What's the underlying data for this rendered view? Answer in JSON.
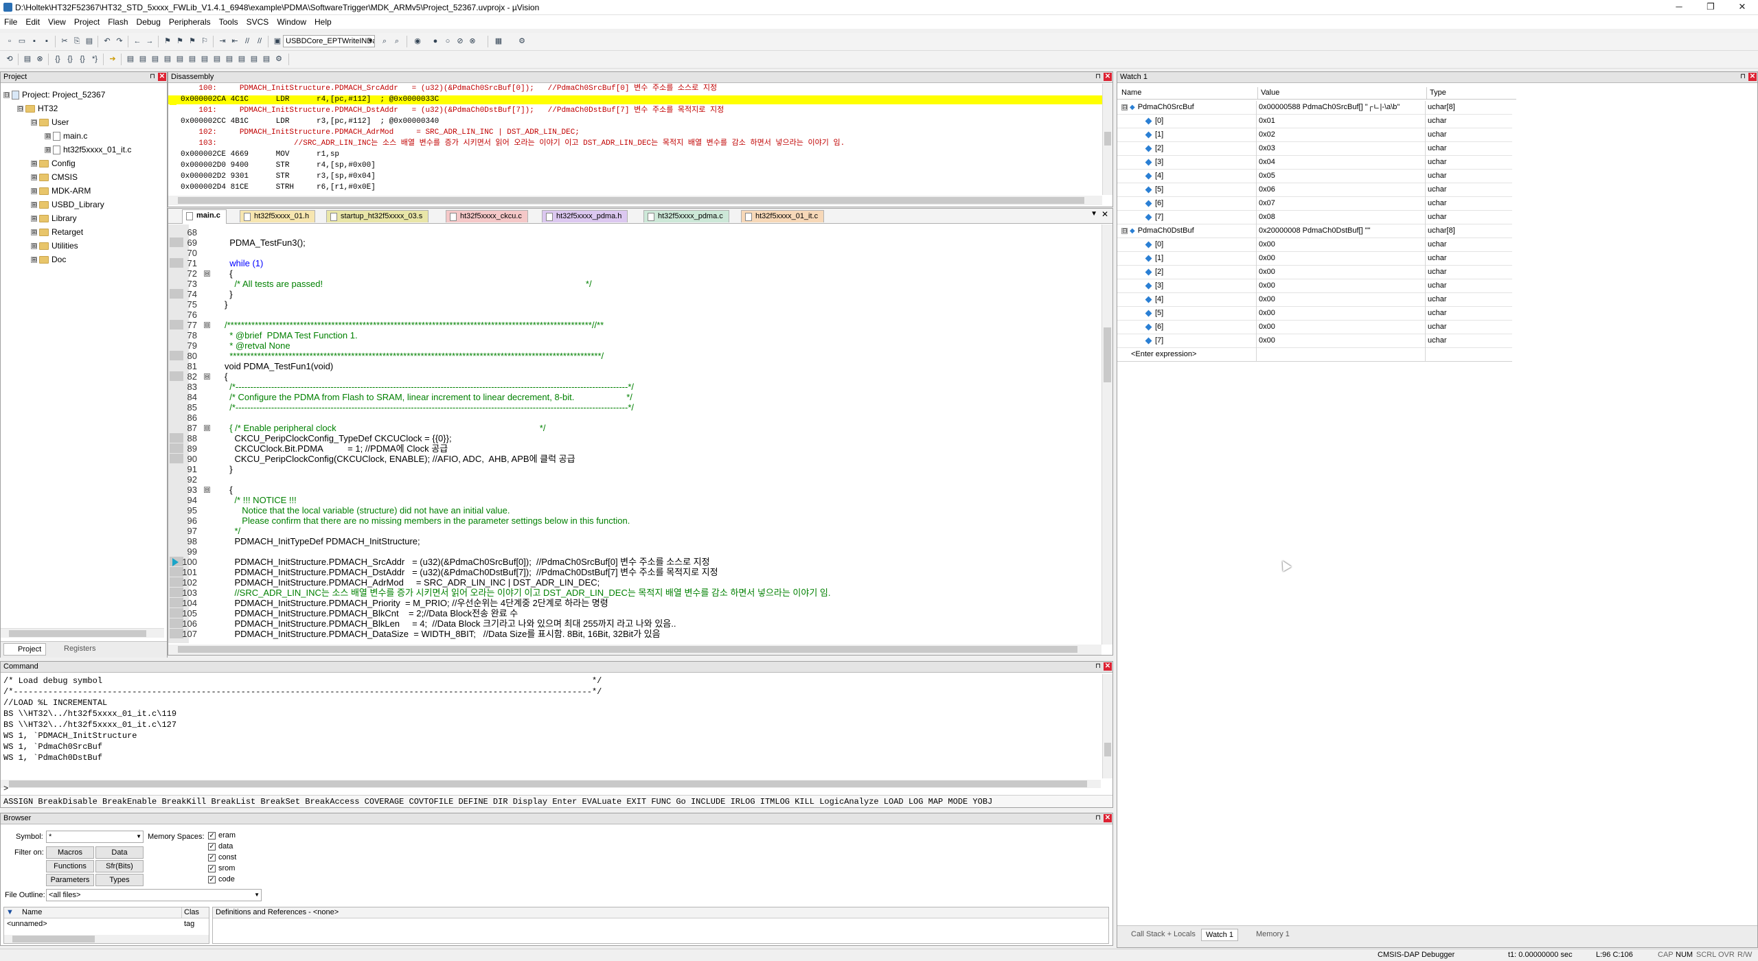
{
  "window": {
    "title": "D:\\Holtek\\HT32F52367\\HT32_STD_5xxxx_FWLib_V1.4.1_6948\\example\\PDMA\\SoftwareTrigger\\MDK_ARMv5\\Project_52367.uvprojx - µVision",
    "minimize": "─",
    "restore": "❐",
    "close": "✕"
  },
  "menu": [
    "File",
    "Edit",
    "View",
    "Project",
    "Flash",
    "Debug",
    "Peripherals",
    "Tools",
    "SVCS",
    "Window",
    "Help"
  ],
  "toolbar": {
    "target_dropdown": "USBDCore_EPTWriteINDa"
  },
  "project": {
    "title": "Project",
    "items": [
      {
        "label": "Project: Project_52367",
        "exp": "⊟"
      },
      {
        "label": "HT32",
        "exp": "⊟"
      },
      {
        "label": "User",
        "exp": "⊟"
      },
      {
        "label": "main.c",
        "exp": "⊞"
      },
      {
        "label": "ht32f5xxxx_01_it.c",
        "exp": "⊞"
      },
      {
        "label": "Config",
        "exp": "⊞"
      },
      {
        "label": "CMSIS",
        "exp": "⊞"
      },
      {
        "label": "MDK-ARM",
        "exp": "⊞"
      },
      {
        "label": "USBD_Library",
        "exp": "⊞"
      },
      {
        "label": "Library",
        "exp": "⊞"
      },
      {
        "label": "Retarget",
        "exp": "⊞"
      },
      {
        "label": "Utilities",
        "exp": "⊞"
      },
      {
        "label": "Doc",
        "exp": "⊞"
      }
    ],
    "tabs": [
      "Project",
      "Registers"
    ]
  },
  "disassembly": {
    "title": "Disassembly",
    "lines": [
      "    100:     PDMACH_InitStructure.PDMACH_SrcAddr   = (u32)(&PdmaCh0SrcBuf[0]);   //PdmaCh0SrcBuf[0] 변수 주소를 소스로 지정",
      "0x000002CA 4C1C      LDR      r4,[pc,#112]  ; @0x0000033C",
      "    101:     PDMACH_InitStructure.PDMACH_DstAddr   = (u32)(&PdmaCh0DstBuf[7]);   //PdmaCh0DstBuf[7] 변수 주소를 목적지로 지정",
      "0x000002CC 4B1C      LDR      r3,[pc,#112]  ; @0x00000340",
      "    102:     PDMACH_InitStructure.PDMACH_AdrMod     = SRC_ADR_LIN_INC | DST_ADR_LIN_DEC;",
      "    103:                 //SRC_ADR_LIN_INC는 소스 배열 변수를 증가 시키면서 읽어 오라는 이야기 이고 DST_ADR_LIN_DEC는 목적지 배열 변수를 감소 하면서 넣으라는 이야기 임.",
      "0x000002CE 4669      MOV      r1,sp",
      "0x000002D0 9400      STR      r4,[sp,#0x00]",
      "0x000002D2 9301      STR      r3,[sp,#0x04]",
      "0x000002D4 81CE      STRH     r6,[r1,#0x0E]"
    ]
  },
  "tabs": [
    {
      "label": "main.c",
      "color": "#f7e6b0",
      "active": true
    },
    {
      "label": "ht32f5xxxx_01.h",
      "color": "#f7e6b0"
    },
    {
      "label": "startup_ht32f5xxxx_03.s",
      "color": "#e9e6a8"
    },
    {
      "label": "ht32f5xxxx_ckcu.c",
      "color": "#f5c8c8"
    },
    {
      "label": "ht32f5xxxx_pdma.h",
      "color": "#dcc8f0"
    },
    {
      "label": "ht32f5xxxx_pdma.c",
      "color": "#cde8d8"
    },
    {
      "label": "ht32f5xxxx_01_it.c",
      "color": "#f7d8b8"
    }
  ],
  "editor": {
    "lines": [
      {
        "n": "68",
        "t": "",
        "c": ""
      },
      {
        "n": "69",
        "t": "  PDMA_TestFun3();",
        "c": ""
      },
      {
        "n": "70",
        "t": "",
        "c": ""
      },
      {
        "n": "71",
        "t": "  while (1)",
        "c": "kw"
      },
      {
        "n": "72",
        "t": "  {",
        "c": ""
      },
      {
        "n": "73",
        "t": "    /* All tests are passed!                                                                                                          */",
        "c": "cm"
      },
      {
        "n": "74",
        "t": "  }",
        "c": ""
      },
      {
        "n": "75",
        "t": "}",
        "c": ""
      },
      {
        "n": "76",
        "t": "",
        "c": ""
      },
      {
        "n": "77",
        "t": "/*********************************************************************************************************//**",
        "c": "cm"
      },
      {
        "n": "78",
        "t": "  * @brief  PDMA Test Function 1.",
        "c": "cm"
      },
      {
        "n": "79",
        "t": "  * @retval None",
        "c": "cm"
      },
      {
        "n": "80",
        "t": "  ***********************************************************************************************************/",
        "c": "cm"
      },
      {
        "n": "81",
        "t": "void PDMA_TestFun1(void)",
        "c": ""
      },
      {
        "n": "82",
        "t": "{",
        "c": ""
      },
      {
        "n": "83",
        "t": "  /*------------------------------------------------------------------------------------------------------------------------------------*/",
        "c": "cm"
      },
      {
        "n": "84",
        "t": "  /* Configure the PDMA from Flash to SRAM, linear increment to linear decrement, 8-bit.                     */",
        "c": "cm"
      },
      {
        "n": "85",
        "t": "  /*------------------------------------------------------------------------------------------------------------------------------------*/",
        "c": "cm"
      },
      {
        "n": "86",
        "t": "",
        "c": ""
      },
      {
        "n": "87",
        "t": "  { /* Enable peripheral clock                                                                                  */",
        "c": "cm"
      },
      {
        "n": "88",
        "t": "    CKCU_PeripClockConfig_TypeDef CKCUClock = {{0}};",
        "c": ""
      },
      {
        "n": "89",
        "t": "    CKCUClock.Bit.PDMA          = 1; //PDMA에 Clock 공급",
        "c": ""
      },
      {
        "n": "90",
        "t": "    CKCU_PeripClockConfig(CKCUClock, ENABLE); //AFIO, ADC,  AHB, APB에 클럭 공급",
        "c": ""
      },
      {
        "n": "91",
        "t": "  }",
        "c": ""
      },
      {
        "n": "92",
        "t": "",
        "c": ""
      },
      {
        "n": "93",
        "t": "  {",
        "c": ""
      },
      {
        "n": "94",
        "t": "    /* !!! NOTICE !!!",
        "c": "cm"
      },
      {
        "n": "95",
        "t": "       Notice that the local variable (structure) did not have an initial value.",
        "c": "cm"
      },
      {
        "n": "96",
        "t": "       Please confirm that there are no missing members in the parameter settings below in this function.",
        "c": "cm"
      },
      {
        "n": "97",
        "t": "    */",
        "c": "cm"
      },
      {
        "n": "98",
        "t": "    PDMACH_InitTypeDef PDMACH_InitStructure;",
        "c": ""
      },
      {
        "n": "99",
        "t": "",
        "c": ""
      },
      {
        "n": "100",
        "t": "    PDMACH_InitStructure.PDMACH_SrcAddr   = (u32)(&PdmaCh0SrcBuf[0]);  //PdmaCh0SrcBuf[0] 변수 주소를 소스로 지정",
        "c": ""
      },
      {
        "n": "101",
        "t": "    PDMACH_InitStructure.PDMACH_DstAddr   = (u32)(&PdmaCh0DstBuf[7]);  //PdmaCh0DstBuf[7] 변수 주소를 목적지로 지정",
        "c": ""
      },
      {
        "n": "102",
        "t": "    PDMACH_InitStructure.PDMACH_AdrMod     = SRC_ADR_LIN_INC | DST_ADR_LIN_DEC;",
        "c": ""
      },
      {
        "n": "103",
        "t": "    //SRC_ADR_LIN_INC는 소스 배열 변수를 증가 시키면서 읽어 오라는 이야기 이고 DST_ADR_LIN_DEC는 목적지 배열 변수를 감소 하면서 넣으라는 이야기 임.",
        "c": "cm"
      },
      {
        "n": "104",
        "t": "    PDMACH_InitStructure.PDMACH_Priority  = M_PRIO; //우선순위는 4단계중 2단계로 하라는 명령",
        "c": ""
      },
      {
        "n": "105",
        "t": "    PDMACH_InitStructure.PDMACH_BlkCnt    = 2;//Data Block전송 완료 수",
        "c": ""
      },
      {
        "n": "106",
        "t": "    PDMACH_InitStructure.PDMACH_BlkLen     = 4;  //Data Block 크기라고 나와 있으며 최대 255까지 라고 나와 있음..",
        "c": ""
      },
      {
        "n": "107",
        "t": "    PDMACH_InitStructure.PDMACH_DataSize  = WIDTH_8BIT;   //Data Size를 표시함. 8Bit, 16Bit, 32Bit가 있음",
        "c": ""
      }
    ]
  },
  "command": {
    "title": "Command",
    "lines": [
      "/* Load debug symbol                                                                                                   */",
      "/*---------------------------------------------------------------------------------------------------------------------*/",
      "//LOAD %L INCREMENTAL",
      "BS \\\\HT32\\../ht32f5xxxx_01_it.c\\119",
      "BS \\\\HT32\\../ht32f5xxxx_01_it.c\\127",
      "WS 1, `PDMACH_InitStructure",
      "WS 1, `PdmaCh0SrcBuf",
      "WS 1, `PdmaCh0DstBuf"
    ],
    "prompt": ">",
    "hint": "ASSIGN BreakDisable BreakEnable BreakKill BreakList BreakSet BreakAccess COVERAGE COVTOFILE DEFINE DIR Display Enter EVALuate EXIT FUNC Go INCLUDE IRLOG ITMLOG KILL LogicAnalyze LOAD LOG MAP MODE YOBJ"
  },
  "browser": {
    "title": "Browser",
    "symbol_label": "Symbol:",
    "symbol_value": "*",
    "filter_label": "Filter on:",
    "memspaces_label": "Memory Spaces:",
    "filters": [
      "Macros",
      "Data",
      "Functions",
      "Sfr(Bits)",
      "Parameters",
      "Types"
    ],
    "spaces": [
      "eram",
      "data",
      "const",
      "srom",
      "code"
    ],
    "file_outline_label": "File Outline:",
    "file_outline_value": "<all files>",
    "col_name": "Name",
    "col_class": "Clas",
    "row_name": "<unnamed>",
    "row_class": "tag",
    "defs": "Definitions and References - <none>"
  },
  "watch": {
    "title": "Watch 1",
    "cols": [
      "Name",
      "Value",
      "Type"
    ],
    "rows": [
      {
        "indent": 0,
        "exp": "⊟",
        "name": "PdmaCh0SrcBuf",
        "value": "0x00000588 PdmaCh0SrcBuf[] \"┌ㄴ|-\\a\\b\"",
        "type": "uchar[8]"
      },
      {
        "indent": 1,
        "name": "[0]",
        "value": "0x01",
        "type": "uchar"
      },
      {
        "indent": 1,
        "name": "[1]",
        "value": "0x02",
        "type": "uchar"
      },
      {
        "indent": 1,
        "name": "[2]",
        "value": "0x03",
        "type": "uchar"
      },
      {
        "indent": 1,
        "name": "[3]",
        "value": "0x04",
        "type": "uchar"
      },
      {
        "indent": 1,
        "name": "[4]",
        "value": "0x05",
        "type": "uchar"
      },
      {
        "indent": 1,
        "name": "[5]",
        "value": "0x06",
        "type": "uchar"
      },
      {
        "indent": 1,
        "name": "[6]",
        "value": "0x07",
        "type": "uchar"
      },
      {
        "indent": 1,
        "name": "[7]",
        "value": "0x08",
        "type": "uchar"
      },
      {
        "indent": 0,
        "exp": "⊟",
        "name": "PdmaCh0DstBuf",
        "value": "0x20000008 PdmaCh0DstBuf[] \"\"",
        "type": "uchar[8]"
      },
      {
        "indent": 1,
        "name": "[0]",
        "value": "0x00",
        "type": "uchar"
      },
      {
        "indent": 1,
        "name": "[1]",
        "value": "0x00",
        "type": "uchar"
      },
      {
        "indent": 1,
        "name": "[2]",
        "value": "0x00",
        "type": "uchar"
      },
      {
        "indent": 1,
        "name": "[3]",
        "value": "0x00",
        "type": "uchar"
      },
      {
        "indent": 1,
        "name": "[4]",
        "value": "0x00",
        "type": "uchar"
      },
      {
        "indent": 1,
        "name": "[5]",
        "value": "0x00",
        "type": "uchar"
      },
      {
        "indent": 1,
        "name": "[6]",
        "value": "0x00",
        "type": "uchar"
      },
      {
        "indent": 1,
        "name": "[7]",
        "value": "0x00",
        "type": "uchar"
      }
    ],
    "enter": "<Enter expression>",
    "tabs": [
      "Call Stack + Locals",
      "Watch 1",
      "Memory 1"
    ]
  },
  "status": {
    "debugger": "CMSIS-DAP Debugger",
    "time": "t1: 0.00000000 sec",
    "pos": "L:96 C:106",
    "caps": "CAP",
    "num": "NUM",
    "scrl": "SCRL",
    "ovr": "OVR",
    "rw": "R/W"
  },
  "colors": {
    "highlight": "#ffff00",
    "accent": "#0a64ad"
  }
}
